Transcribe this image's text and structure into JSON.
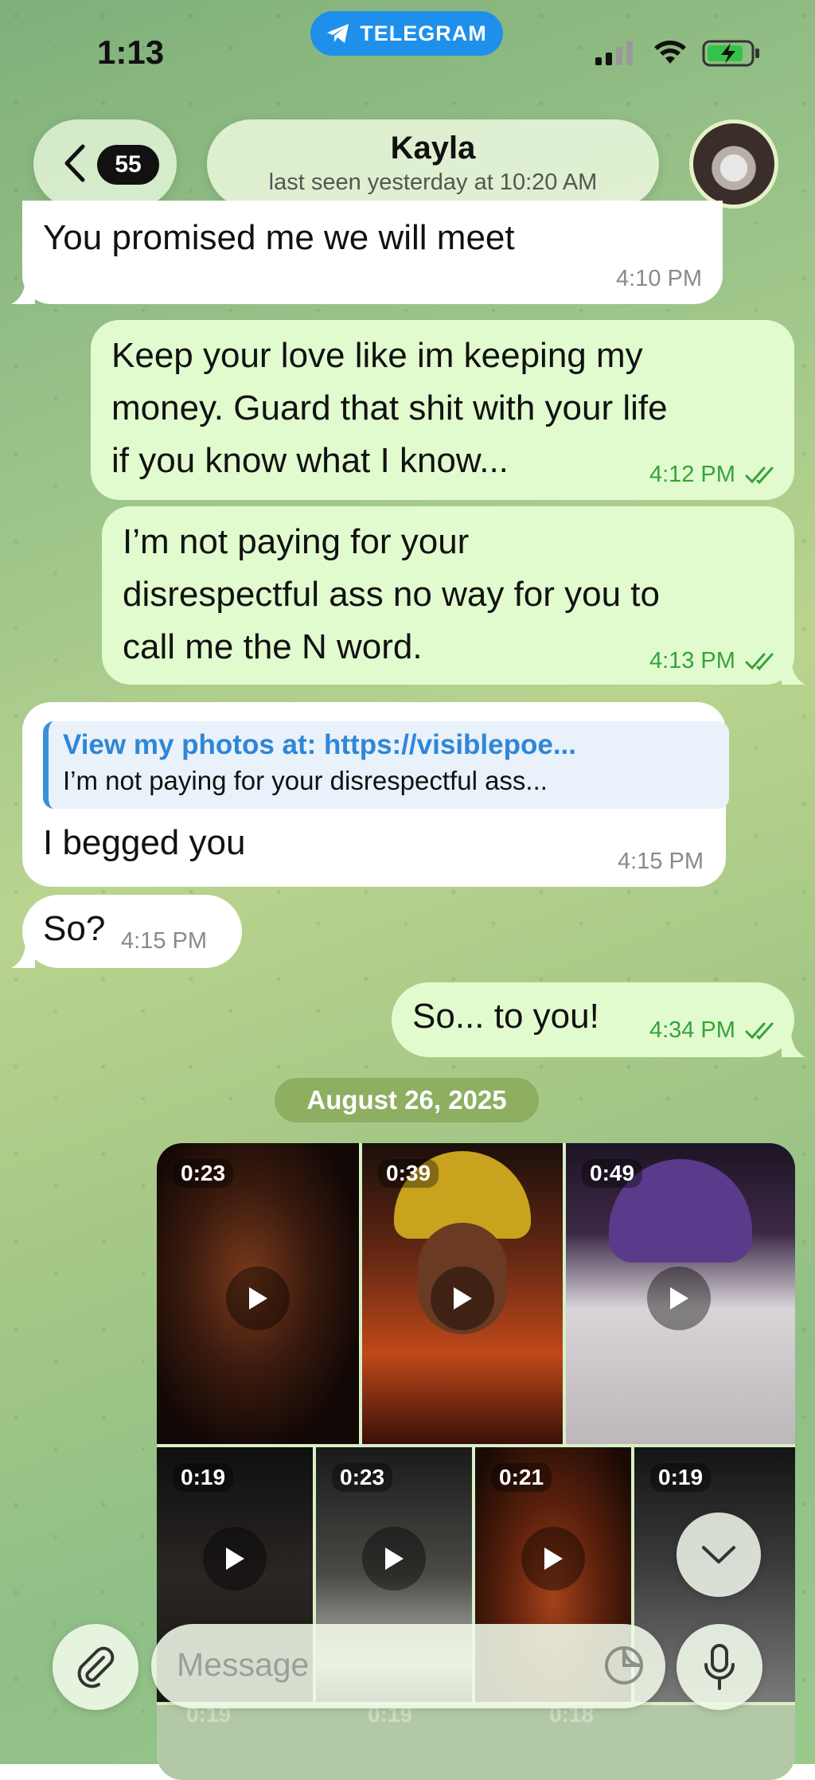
{
  "status_bar": {
    "time": "1:13",
    "pill_label": "TELEGRAM"
  },
  "header": {
    "back_count": "55",
    "contact_name": "Kayla",
    "last_seen": "last seen yesterday at 10:20 AM"
  },
  "messages": [
    {
      "dir": "in",
      "text": "You promised me we will meet",
      "time": "4:10 PM"
    },
    {
      "dir": "out",
      "lines": [
        "Keep your love like im keeping my",
        "money. Guard that shit with your life",
        "if you know what I know..."
      ],
      "time": "4:12 PM"
    },
    {
      "dir": "out",
      "lines": [
        "I’m not paying for your",
        "disrespectful ass no way for you to",
        "call me the N word."
      ],
      "time": "4:13 PM"
    },
    {
      "dir": "in",
      "reply_title": "View my photos at: https://visiblepoe...",
      "reply_text": "I’m not paying for your disrespectful ass...",
      "text": "I begged you",
      "time": "4:15 PM"
    },
    {
      "dir": "in",
      "text": "So?",
      "time": "4:15 PM"
    },
    {
      "dir": "out",
      "text": "So... to you!",
      "time": "4:34 PM"
    }
  ],
  "date_separator": "August 26, 2025",
  "videos": [
    {
      "duration": "0:23"
    },
    {
      "duration": "0:39"
    },
    {
      "duration": "0:49"
    },
    {
      "duration": "0:19"
    },
    {
      "duration": "0:23"
    },
    {
      "duration": "0:21"
    },
    {
      "duration": "0:19"
    }
  ],
  "ghost_durations": [
    "0:19",
    "0:19",
    "0:18"
  ],
  "composer": {
    "placeholder": "Message"
  },
  "colors": {
    "incoming": "#ffffff",
    "outgoing": "#e1fbcf",
    "accent": "#35a33a",
    "link": "#2f86d6"
  }
}
